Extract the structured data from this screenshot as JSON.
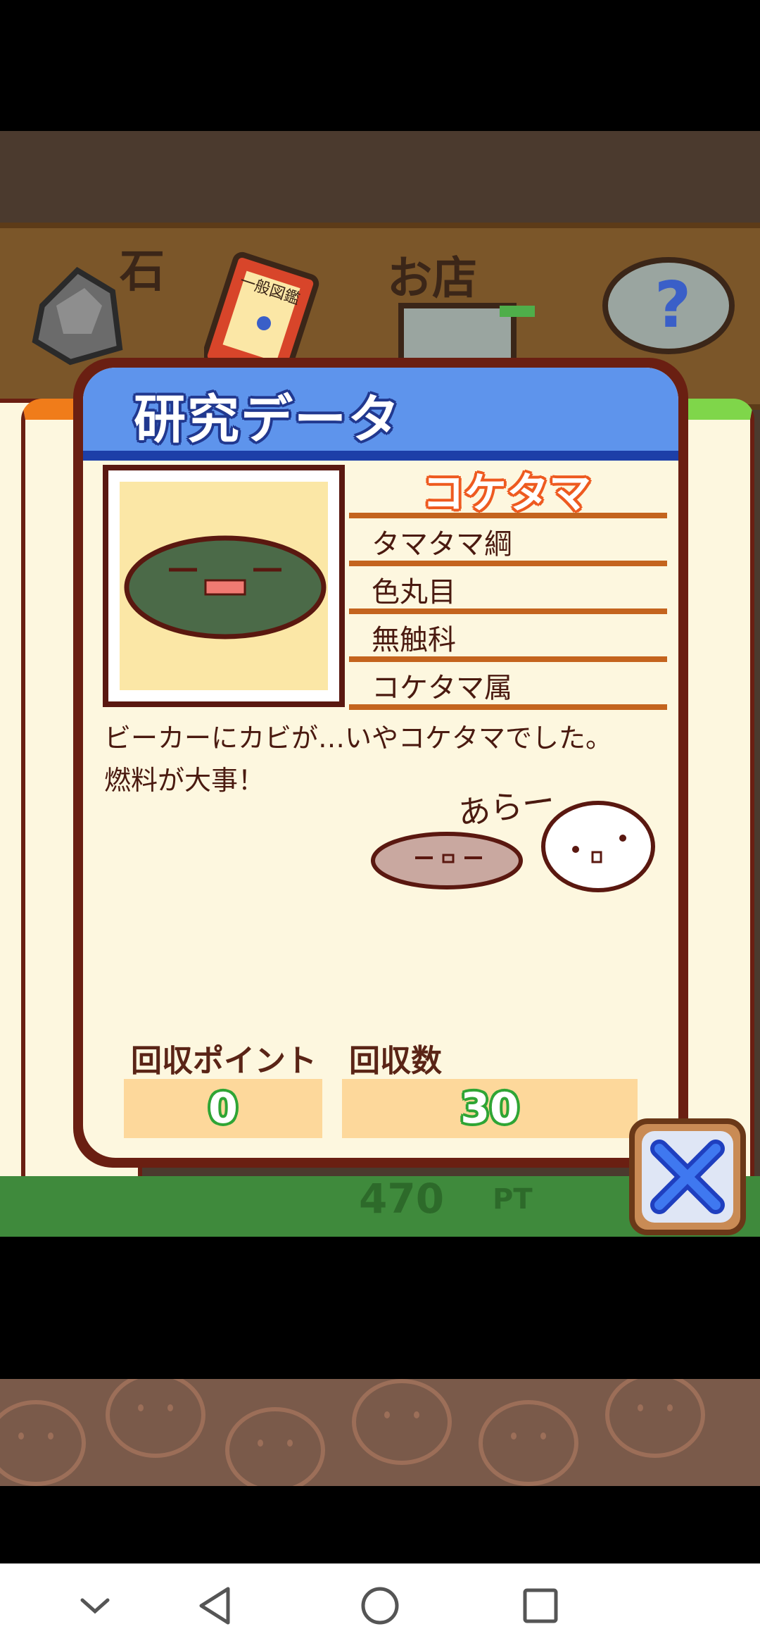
{
  "top_menu": {
    "stone_label": "石",
    "shop_label": "お店",
    "book_label": "一般図鑑"
  },
  "dialog": {
    "title": "研究データ",
    "creature_name": "コケタマ",
    "taxonomy": [
      "タマタマ綱",
      "色丸目",
      "無触科",
      "コケタマ属"
    ],
    "description_lines": [
      "ビーカーにカビが…いやコケタマでした。",
      "燃料が大事！"
    ],
    "doodle_caption": "あらー",
    "stats": {
      "points_label": "回収ポイント",
      "points_value": "0",
      "count_label": "回収数",
      "count_value": "30"
    }
  },
  "background": {
    "pt_value": "470",
    "pt_unit": "PT"
  },
  "icons": {
    "close": "close-x-icon",
    "help": "question-icon",
    "nav_back": "back-triangle-icon",
    "nav_home": "home-circle-icon",
    "nav_recents": "recents-square-icon",
    "nav_collapse": "chevron-down-icon"
  },
  "colors": {
    "header_blue": "#5e94ec",
    "panel_border": "#6a1f12",
    "paper": "#fdf7df",
    "name_orange": "#ee5a20",
    "value_green": "#2fa535"
  }
}
